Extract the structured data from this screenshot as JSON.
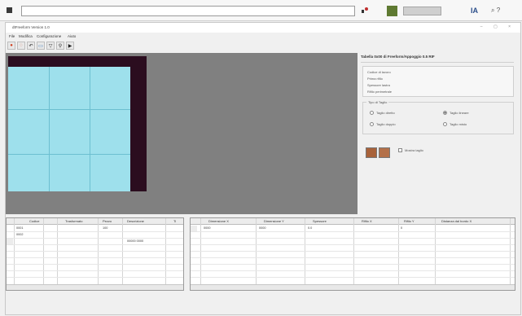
{
  "window": {
    "title": "dtFreeform Version 1.0",
    "controls": "– ▢ ×"
  },
  "menubar": [
    "File",
    "Modifica",
    "Configurazione",
    "Aiuto"
  ],
  "toolbar1": [
    "●",
    "◌",
    "↶",
    "▭",
    "▽",
    "⚲",
    "▶"
  ],
  "toolbar2": [
    "▢",
    "▭",
    "▣",
    "▤",
    "▥",
    "▦",
    "▧",
    "▨",
    "▩",
    "▪",
    "▫",
    "⬚",
    "◆",
    "◇",
    "▬"
  ],
  "topbar": {
    "address": "",
    "lang_label": "IA",
    "extra_label": "⌕ ?"
  },
  "sheet": {
    "header_labels": [
      "",
      "",
      ""
    ],
    "cells": [
      "",
      "",
      "",
      "",
      "",
      "",
      "",
      "",
      ""
    ]
  },
  "props": {
    "title": "Tabella 0x00 di Freeform/Appoggio 0.5 RIF",
    "rows": [
      {
        "label": "Codice di lavoro",
        "value": ""
      },
      {
        "label": "Prima rifilo",
        "value": ""
      },
      {
        "label": "Spessore lastra",
        "value": ""
      },
      {
        "label": "Rifilo perimetrale",
        "value": ""
      }
    ],
    "group_title": "Tipo di Taglio",
    "radios": [
      {
        "label": "Taglio diretto",
        "on": false
      },
      {
        "label": "Taglio lineare",
        "on": true
      },
      {
        "label": "Taglio doppio",
        "on": false
      },
      {
        "label": "Taglio misto",
        "on": false
      }
    ],
    "checkbox_label": "Mostra taglio"
  },
  "grid1": {
    "headers": [
      "Codice",
      "Trasformato",
      "Pezzo",
      "Descrizione",
      "Ti"
    ],
    "rows": [
      [
        "0001",
        "",
        "",
        "100",
        ""
      ],
      [
        "0002",
        "",
        "",
        "",
        ""
      ],
      [
        "",
        "",
        "",
        "",
        "00000 0000"
      ]
    ]
  },
  "grid2": {
    "headers": [
      "Dimensione X",
      "Dimensione Y",
      "Spessore",
      "Rifilo X",
      "Rifilo Y",
      "Distanza dal bordo X"
    ],
    "rows": [
      [
        "0000",
        "",
        "0000",
        "0.0",
        "",
        "0"
      ]
    ]
  }
}
